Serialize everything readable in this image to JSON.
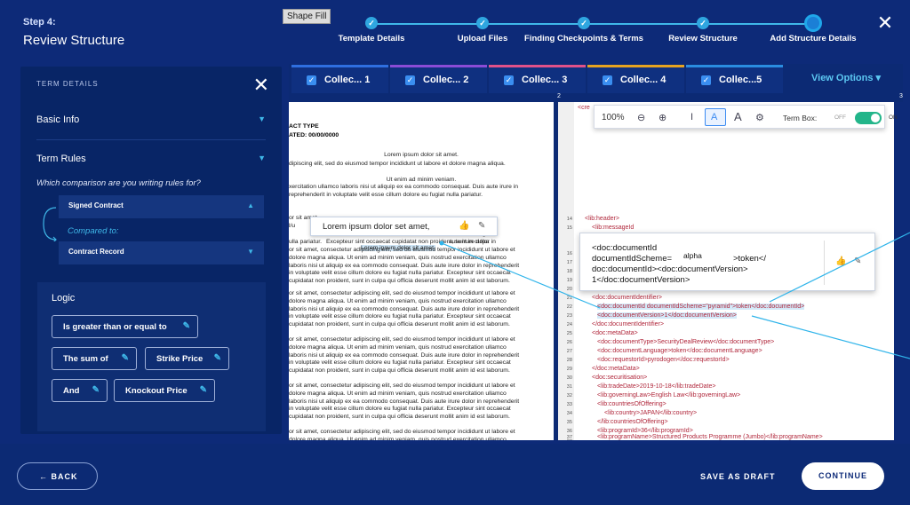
{
  "header": {
    "step_label": "Step 4:",
    "title": "Review Structure",
    "tooltip": "Shape Fill",
    "steps": [
      "Template Details",
      "Upload Files",
      "Finding Checkpoints & Terms",
      "Review Structure",
      "Add Structure Details"
    ]
  },
  "panel": {
    "heading": "TERM DETAILS",
    "basic_info": "Basic Info",
    "term_rules": "Term Rules",
    "question": "Which comparison are you writing rules for?",
    "signed_contract": "Signed Contract",
    "compared_to": "Compared to:",
    "contract_record": "Contract Record",
    "logic_title": "Logic",
    "chips": [
      "Is greater than or equal to",
      "The sum of",
      "Strike Price",
      "And",
      "Knockout Price"
    ]
  },
  "tabs": [
    "Collec... 1",
    "Collec... 2",
    "Collec... 3",
    "Collec... 4",
    "Collec...5"
  ],
  "tab_colors": [
    "#2f6fe0",
    "#8a4cd6",
    "#e0518a",
    "#e6a321",
    "#2a8de0"
  ],
  "view_options": "View Options",
  "ruler_numbers": [
    "2",
    "3"
  ],
  "doc_a": {
    "head1": "ACT TYPE",
    "head2": "ATED: 00/00/0000",
    "center1": "Lorem ipsum dolor sit amet.",
    "para1": "dipiscing elit, sed do eiusmod tempor incididunt ut labore et dolore magna aliqua.",
    "center2": "Ut enim ad minim veniam.",
    "para2": "xercitation ullamco laboris nisi ut aliquip ex ea commodo consequat. Duis aute irure in reprehenderit in voluptate velit esse cillum dolore eu fugiat nulla pariatur.",
    "para3a": "or sit amet,",
    "para3b": "l/u",
    "para3c": "et dolore magna",
    "para3d": "aute irure dolor in",
    "para3e": "ulla pariatur.",
    "para3f": "Excepteur sint occaecat cupidatat non proident, sunt in culpa",
    "para3g": "or sit amet, consectetur adipiscing elit, sed do eiusmod tempor incididunt ut labore et dolore magna aliqua. Ut enim ad minim veniam, quis nostrud exercitation ullamco laboris nisi ut aliquip ex ea commodo consequat. Duis aute irure dolor in reprehenderit in voluptate velit esse cillum dolore eu fugiat nulla pariatur. Excepteur sint occaecat cupidatat non proident, sunt in culpa qui officia deserunt mollit anim id est laborum.",
    "highlight": "Lorem ipsum dolor sit amet,",
    "para4": "or sit amet, consectetur adipiscing elit, sed do eiusmod tempor incididunt ut labore et dolore magna aliqua. Ut enim ad minim veniam, quis nostrud exercitation ullamco laboris nisi ut aliquip ex ea commodo consequat. Duis aute irure dolor in reprehenderit in voluptate velit esse cillum dolore eu fugiat nulla pariatur. Excepteur sint occaecat cupidatat non proident, sunt in culpa qui officia deserunt mollit anim id est laborum.",
    "para5": "or sit amet, consectetur adipiscing elit, sed do eiusmod tempor incididunt ut labore et dolore magna aliqua. Ut enim ad minim veniam, quis nostrud exercitation ullamco laboris nisi ut aliquip ex ea commodo consequat. Duis aute irure dolor in reprehenderit in voluptate velit esse cillum dolore eu fugiat nulla pariatur. Excepteur sint occaecat cupidatat non proident, sunt in culpa qui officia deserunt mollit anim id est laborum.",
    "para6": "or sit amet, consectetur adipiscing elit, sed do eiusmod tempor incididunt ut labore et dolore magna aliqua. Ut enim ad minim veniam, quis nostrud exercitation ullamco laboris nisi ut aliquip ex ea commodo consequat. Duis aute irure dolor in reprehenderit in voluptate velit esse cillum dolore eu fugiat nulla pariatur. Excepteur sint occaecat cupidatat non proident, sunt in culpa qui officia deserunt mollit anim id est laborum.",
    "para7": "or sit amet, consectetur adipiscing elit, sed do eiusmod tempor incididunt ut labore et dolore magna aliqua. Ut enim ad minim veniam, quis nostrud exercitation ullamco laboris nisi ut aliquip ex ea commodo consequat. Duis aute irure dolor in reprehenderit in voluptate velit esse cillum dolore eu fugiat nulla pariatur. Excepteur sint occaecat cupidatat non proident, sunt in culpa qui officia deserunt mollit anim id est laborum.",
    "popup_text": "Lorem ipsum dolor set amet,"
  },
  "toolbar": {
    "zoom": "100%",
    "term_box_label": "Term Box:",
    "off": "OFF",
    "on": "ON"
  },
  "doc_b": {
    "line_numbers": [
      "14",
      "15",
      "16",
      "17",
      "18",
      "19",
      "20",
      "21",
      "22",
      "23",
      "24",
      "25",
      "26",
      "27",
      "28",
      "29",
      "30",
      "31",
      "32",
      "33",
      "34",
      "35",
      "36",
      "37",
      "38"
    ],
    "first_tag": "<cre",
    "header_line": "<lib:header>",
    "msg_line": "<lib:messageId",
    "xml_lines": [
      "<doc:documentIdentifier>",
      "<doc:documentId documentIdScheme=\"pyramid\">token</doc:documentId>",
      "<doc:documentVersion>1</doc:documentVersion>",
      "</doc:documentIdentifier>",
      "<doc:metaData>",
      "<doc:documentType>SecurityDealReview</doc:documentType>",
      "<doc:documentLanguage>token</doc:documentLanguage>",
      "<doc:requestorId>pyrodogen</doc:requestorId>",
      "</doc:metaData>",
      "<doc:securitisation>",
      "<lib:tradeDate>2019-10-18</lib:tradeDate>",
      "<lib:governingLaw>English Law</lib:governingLaw>",
      "<lib:countriesOfOffering>",
      "<lib:country>JAPAN</lib:country>",
      "</lib:countriesOfOffering>",
      "<lib:programId>36</lib:programId>",
      "<lib:programName>Structured Products Programme (Jumbo)</lib:programName>"
    ],
    "popup_lines": [
      "<doc:documentId",
      "documentIdScheme=",
      "alpha",
      ">token</",
      "doc:documentId><doc:documentVersion>",
      "1</doc:documentVersion>"
    ]
  },
  "footer": {
    "back": "BACK",
    "save_draft": "SAVE AS DRAFT",
    "continue": "CONTINUE"
  }
}
